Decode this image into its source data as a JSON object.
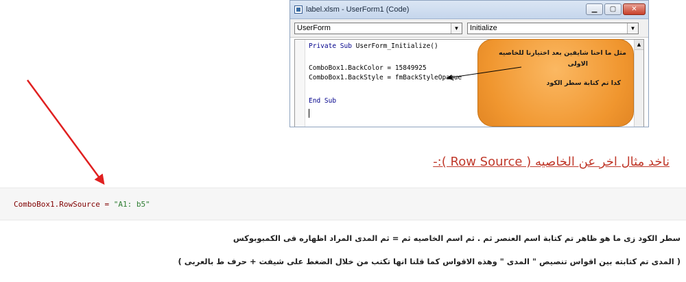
{
  "window": {
    "title": "label.xlsm - UserForm1 (Code)",
    "object_combo": "UserForm",
    "procedure_combo": "Initialize",
    "minimize_glyph": "▁",
    "maximize_glyph": "▢",
    "close_glyph": "✕",
    "dropdown_glyph": "▼",
    "scroll_up_glyph": "▲"
  },
  "code_lines": [
    {
      "kw": "Private Sub",
      "rest": " UserForm_Initialize()"
    },
    {
      "text": "ComboBox1.BackColor = 15849925"
    },
    {
      "text": "ComboBox1.BackStyle = fmBackStyleOpaque"
    },
    {
      "kw": "End Sub",
      "rest": ""
    }
  ],
  "callout": {
    "line1": "مثل ما احنا شايفين بعد اختيارنا للخاصيه",
    "line2": "الاولى",
    "line3": "كدا تم كتابة سطر الكود"
  },
  "heading": "ناخد مثال اخر عن الخاصيه ( Row Source ):-",
  "snippet": {
    "prefix": "ComboBox1.RowSource = ",
    "string": "\"A1: b5\""
  },
  "paragraph1": "سطر الكود زى ما هو ظاهر تم كتابة اسم العنصر ثم .  ثم اسم الخاصيه ثم = ثم المدى المراد اظهاره فى الكمبوبوكس",
  "paragraph2": "( المدى تم كتابته بين اقواس تنصيص \" المدى \"  وهذه الاقواس كما قلنا انها تكتب من خلال الضغط على شيفت + حرف ط بالعربى )",
  "colors": {
    "arrow_red": "#e02020",
    "callout_orange": "#f7a64a",
    "heading_red": "#c0392b",
    "keyword_blue": "#00008b"
  }
}
